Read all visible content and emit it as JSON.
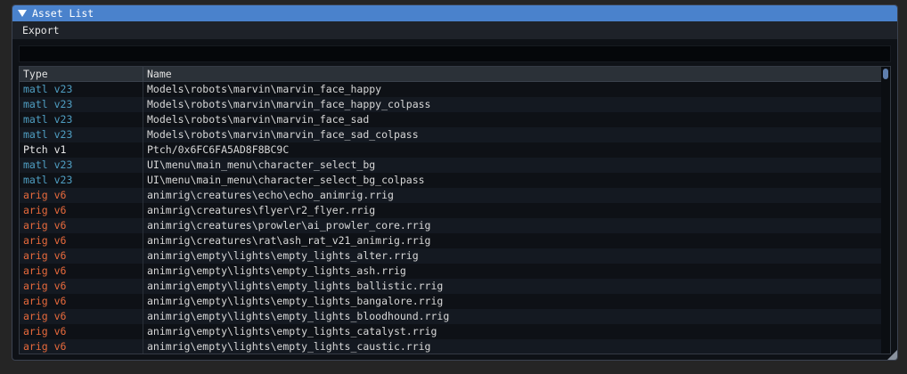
{
  "window": {
    "title": "Asset List"
  },
  "menubar": {
    "export_label": "Export"
  },
  "filter": {
    "value": ""
  },
  "table": {
    "columns": [
      "Type",
      "Name"
    ],
    "rows": [
      {
        "type": "matl v23",
        "kind": "matl",
        "name": "Models\\robots\\marvin\\marvin_face_happy"
      },
      {
        "type": "matl v23",
        "kind": "matl",
        "name": "Models\\robots\\marvin\\marvin_face_happy_colpass"
      },
      {
        "type": "matl v23",
        "kind": "matl",
        "name": "Models\\robots\\marvin\\marvin_face_sad"
      },
      {
        "type": "matl v23",
        "kind": "matl",
        "name": "Models\\robots\\marvin\\marvin_face_sad_colpass"
      },
      {
        "type": "Ptch v1",
        "kind": "ptch",
        "name": "Ptch/0x6FC6FA5AD8F8BC9C"
      },
      {
        "type": "matl v23",
        "kind": "matl",
        "name": "UI\\menu\\main_menu\\character_select_bg"
      },
      {
        "type": "matl v23",
        "kind": "matl",
        "name": "UI\\menu\\main_menu\\character_select_bg_colpass"
      },
      {
        "type": "arig v6",
        "kind": "arig",
        "name": "animrig\\creatures\\echo\\echo_animrig.rrig"
      },
      {
        "type": "arig v6",
        "kind": "arig",
        "name": "animrig\\creatures\\flyer\\r2_flyer.rrig"
      },
      {
        "type": "arig v6",
        "kind": "arig",
        "name": "animrig\\creatures\\prowler\\ai_prowler_core.rrig"
      },
      {
        "type": "arig v6",
        "kind": "arig",
        "name": "animrig\\creatures\\rat\\ash_rat_v21_animrig.rrig"
      },
      {
        "type": "arig v6",
        "kind": "arig",
        "name": "animrig\\empty\\lights\\empty_lights_alter.rrig"
      },
      {
        "type": "arig v6",
        "kind": "arig",
        "name": "animrig\\empty\\lights\\empty_lights_ash.rrig"
      },
      {
        "type": "arig v6",
        "kind": "arig",
        "name": "animrig\\empty\\lights\\empty_lights_ballistic.rrig"
      },
      {
        "type": "arig v6",
        "kind": "arig",
        "name": "animrig\\empty\\lights\\empty_lights_bangalore.rrig"
      },
      {
        "type": "arig v6",
        "kind": "arig",
        "name": "animrig\\empty\\lights\\empty_lights_bloodhound.rrig"
      },
      {
        "type": "arig v6",
        "kind": "arig",
        "name": "animrig\\empty\\lights\\empty_lights_catalyst.rrig"
      },
      {
        "type": "arig v6",
        "kind": "arig",
        "name": "animrig\\empty\\lights\\empty_lights_caustic.rrig"
      }
    ]
  },
  "colors": {
    "title_bar": "#4a82cc",
    "matl": "#4f9ec2",
    "ptch": "#e8e8e8",
    "arig": "#e86a3c"
  },
  "icons": {
    "collapse": "collapse-triangle-icon",
    "resize": "resize-grip-icon"
  }
}
